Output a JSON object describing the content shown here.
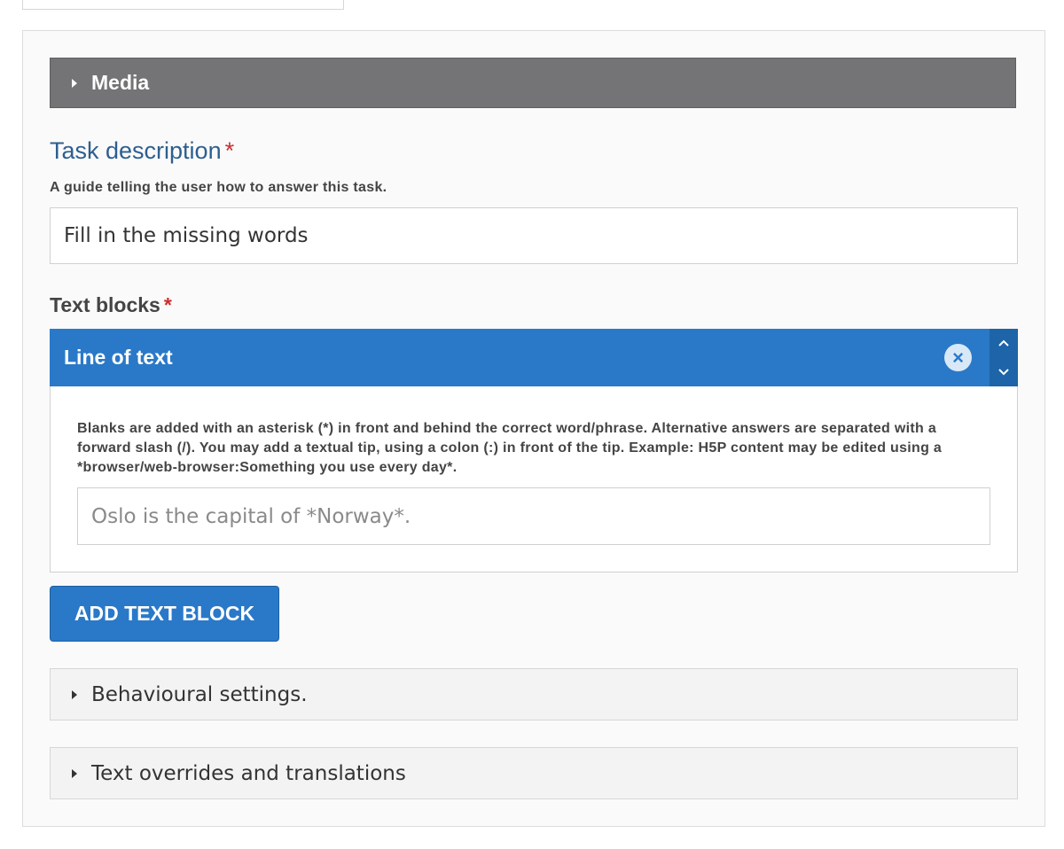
{
  "media": {
    "label": "Media"
  },
  "task": {
    "title": "Task description",
    "required_mark": "*",
    "description": "A guide telling the user how to answer this task.",
    "value": "Fill in the missing words"
  },
  "text_blocks": {
    "label": "Text blocks",
    "required_mark": "*",
    "item": {
      "title": "Line of text",
      "remove_icon": "×",
      "up_icon": "⌃",
      "down_icon": "⌄",
      "description": "Blanks are added with an asterisk (*) in front and behind the correct word/phrase. Alternative answers are separated with a forward slash (/). You may add a textual tip, using a colon (:) in front of the tip. Example: H5P content may be edited using a *browser/web-browser:Something you use every day*.",
      "placeholder": "Oslo is the capital of *Norway*."
    },
    "add_button": "ADD TEXT BLOCK"
  },
  "sections": {
    "behavioural": "Behavioural settings.",
    "overrides": "Text overrides and translations"
  },
  "colors": {
    "accent": "#2a79c8",
    "media_bar": "#747375",
    "title": "#2d5f8f",
    "required": "#cc2e2e"
  }
}
